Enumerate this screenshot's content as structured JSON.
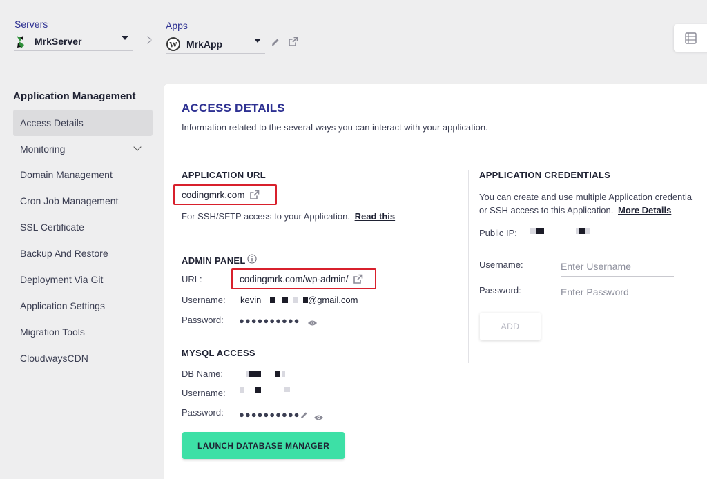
{
  "topbar": {
    "servers_label": "Servers",
    "server_name": "MrkServer",
    "apps_label": "Apps",
    "app_name": "MrkApp"
  },
  "sidebar": {
    "title": "Application Management",
    "items": [
      {
        "label": "Access Details"
      },
      {
        "label": "Monitoring"
      },
      {
        "label": "Domain Management"
      },
      {
        "label": "Cron Job Management"
      },
      {
        "label": "SSL Certificate"
      },
      {
        "label": "Backup And Restore"
      },
      {
        "label": "Deployment Via Git"
      },
      {
        "label": "Application Settings"
      },
      {
        "label": "Migration Tools"
      },
      {
        "label": "CloudwaysCDN"
      }
    ]
  },
  "main": {
    "title": "ACCESS DETAILS",
    "description": "Information related to the several ways you can interact with your application.",
    "app_url": {
      "heading": "APPLICATION URL",
      "url": "codingmrk.com",
      "ssh_note": "For SSH/SFTP access to your Application.",
      "read_this": "Read this"
    },
    "admin_panel": {
      "heading": "ADMIN PANEL",
      "url_label": "URL:",
      "url": "codingmrk.com/wp-admin/",
      "username_label": "Username:",
      "username_prefix": "kevin",
      "username_suffix": "@gmail.com",
      "password_label": "Password:",
      "password_mask": "●●●●●●●●●●"
    },
    "mysql": {
      "heading": "MYSQL ACCESS",
      "db_label": "DB Name:",
      "username_label": "Username:",
      "password_label": "Password:",
      "password_mask": "●●●●●●●●●●",
      "launch_button": "LAUNCH DATABASE MANAGER"
    },
    "credentials": {
      "heading": "APPLICATION CREDENTIALS",
      "desc_line1": "You can create and use multiple Application credentia",
      "desc_line2": "or SSH access to this Application.",
      "more_details": "More Details",
      "public_ip_label": "Public IP:",
      "username_label": "Username:",
      "username_placeholder": "Enter Username",
      "password_label": "Password:",
      "password_placeholder": "Enter Password",
      "add_button": "ADD"
    }
  },
  "colors": {
    "accent": "#2e3192",
    "highlight_box": "#d8202c",
    "launch_button": "#3de0a6"
  }
}
